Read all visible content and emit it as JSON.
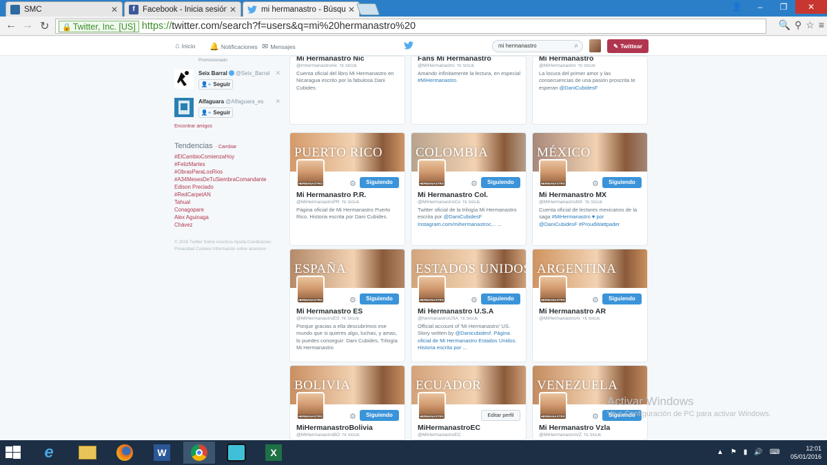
{
  "browser": {
    "tabs": [
      {
        "title": "SMC",
        "favicon_color": "#2c6aa0"
      },
      {
        "title": "Facebook - Inicia sesión o",
        "favicon_color": "#3b5998"
      },
      {
        "title": "mi hermanastro - Búsqued",
        "favicon_color": "#55acee"
      }
    ],
    "ev_label": "Twitter, Inc. [US]",
    "url_scheme": "https://",
    "url_rest": "twitter.com/search?f=users&q=mi%20hermanastro%20"
  },
  "twitter_nav": {
    "home": "Inicio",
    "notifications": "Notificaciones",
    "messages": "Mensajes",
    "search_value": "mi hermanastro",
    "tweet_button": "Twittear"
  },
  "sidebar": {
    "promoted_label": "Promocionado",
    "who_to_follow": [
      {
        "name": "Seix Barral",
        "handle": "@Seix_Barral",
        "follow_label": "Seguir",
        "verified": true
      },
      {
        "name": "Alfaguara",
        "handle": "@Alfaguara_es",
        "follow_label": "Seguir",
        "verified": false
      }
    ],
    "find_friends": "Encontrar amigos",
    "trends_title": "Tendencias",
    "trends_change": "· Cambiar",
    "trends": [
      "#ElCambioComienzaHoy",
      "#FelizMartes",
      "#ObrasParaLosRios",
      "#A34MesesDeTuSiembraComandante",
      "Edison Preciado",
      "#RedCarpetAN",
      "Tahual",
      "Conagopare",
      "Alex Aguinaga",
      "Chávez"
    ],
    "footer": "© 2016 Twitter   Sobre nosotros   Ayuda   Condiciones   Privacidad   Cookies   Información sobre anuncios"
  },
  "cards": [
    {
      "name": "Mi Hermanastro Nic",
      "handle": "@mhermanastronic",
      "follows_you": "Te sigue",
      "button": "Siguiendo",
      "banner_text": "",
      "bio": "Cuenta oficial del libro Mi Hermanastro en Nicaragua escrito por la fabulosa Dani Cubides",
      "bio_link": "",
      "banner_color": "#c98d5c"
    },
    {
      "name": "Fans Mi Hermanastro",
      "handle": "@MIHermanastro",
      "follows_you": "Te sigue",
      "button": "Siguiendo",
      "banner_text": "",
      "bio": "Amando infinitamente la lectura, en especial",
      "bio_link": "#MiHermanastro.",
      "banner_color": "#c98d5c"
    },
    {
      "name": "Mi Hermanastro",
      "handle": "@MiHermanastro",
      "follows_you": "Te sigue",
      "button": "Siguiendo",
      "banner_text": "",
      "bio": "La locura del primer amor y las consecuencias de una pasión proscrita te esperan",
      "bio_link": "@DaniCubidesF",
      "banner_color": "#9a6b4a"
    },
    {
      "name": "Mi Hermanastro P.R.",
      "handle": "@MiHermanastroPR",
      "follows_you": "Te sigue",
      "button": "Siguiendo",
      "banner_text": "PUERTO RICO",
      "bio": "Página oficial de Mi Hermanastro Puerto Rico. Historia escrita por Dani Cubides.",
      "bio_link": "",
      "banner_color": "#d49a6a"
    },
    {
      "name": "Mi Hermanastro Col.",
      "handle": "@MiHermanastroCo",
      "follows_you": "Te sigue",
      "button": "Siguiendo",
      "banner_text": "COLOMBIA",
      "bio": "Twitter oficial de la trilogía Mi Hermanastro escrita por",
      "bio_link": "@DaniCubidesF Instagram.com/mihermanastroc... ...",
      "banner_color": "#b8a38d"
    },
    {
      "name": "Mi Hermanastro MX",
      "handle": "@MiHermanastroMX",
      "follows_you": "Te sigue",
      "button": "Siguiendo",
      "banner_text": "MÉXICO",
      "bio": "Cuenta oficial de lectores mexicanos de la saga",
      "bio_link": "#MiHermanastro ♥ por @DaniCubidesF #ProudWattpader",
      "banner_color": "#a7887a"
    },
    {
      "name": "Mi Hermanastro ES",
      "handle": "@MiHermanastroES",
      "follows_you": "Te sigue",
      "button": "Siguiendo",
      "banner_text": "ESPAÑA",
      "bio": "Porque gracias a ella descubrimos ese mundo que si quieres algo, luchas, y amas, lo puedes conseguir: Dani Cubides, Trilogía Mi Hermanastro",
      "bio_link": "",
      "banner_color": "#b48a6a"
    },
    {
      "name": "Mi Hermanastro U.S.A",
      "handle": "@hermanastroUSA",
      "follows_you": "Te sigue",
      "button": "Siguiendo",
      "banner_text": "ESTADOS UNIDOS",
      "bio": "Official account of 'Mi Hermanastro' US. Story written by",
      "bio_link": "@Danicubidesf. Página oficial de Mi Hermanastro Estados Unidos. Historia escrita por ...",
      "banner_color": "#d2a57c"
    },
    {
      "name": "Mi Hermanastro AR",
      "handle": "@MiHermanastroAr",
      "follows_you": "Te sigue",
      "button": "Siguiendo",
      "banner_text": "ARGENTINA",
      "bio": "",
      "bio_link": "",
      "banner_color": "#cf935f"
    },
    {
      "name": "MiHermanastroBolivia",
      "handle": "@MiHermanastroBO",
      "follows_you": "Te sigue",
      "button": "Siguiendo",
      "banner_text": "BOLIVIA",
      "bio": "",
      "bio_link": "",
      "banner_color": "#c98f62"
    },
    {
      "name": "MiHermanastroEC",
      "handle": "@MiHermanastroEC",
      "follows_you": "",
      "button": "Editar perfil",
      "banner_text": "ECUADOR",
      "bio": "",
      "bio_link": "",
      "banner_color": "#d3a27a"
    },
    {
      "name": "Mi Hermanastro Vzla",
      "handle": "@MiHermanastroVZ",
      "follows_you": "Te sigue",
      "button": "Siguiendo",
      "banner_text": "VENEZUELA",
      "bio": "",
      "bio_link": "",
      "banner_color": "#c38b5f"
    }
  ],
  "pic_label": "HERMANASTRO",
  "watermark": {
    "title": "Activar Windows",
    "subtitle": "Ve a Configuración de PC para activar Windows."
  },
  "taskbar": {
    "time": "12:01",
    "date": "05/01/2016"
  }
}
